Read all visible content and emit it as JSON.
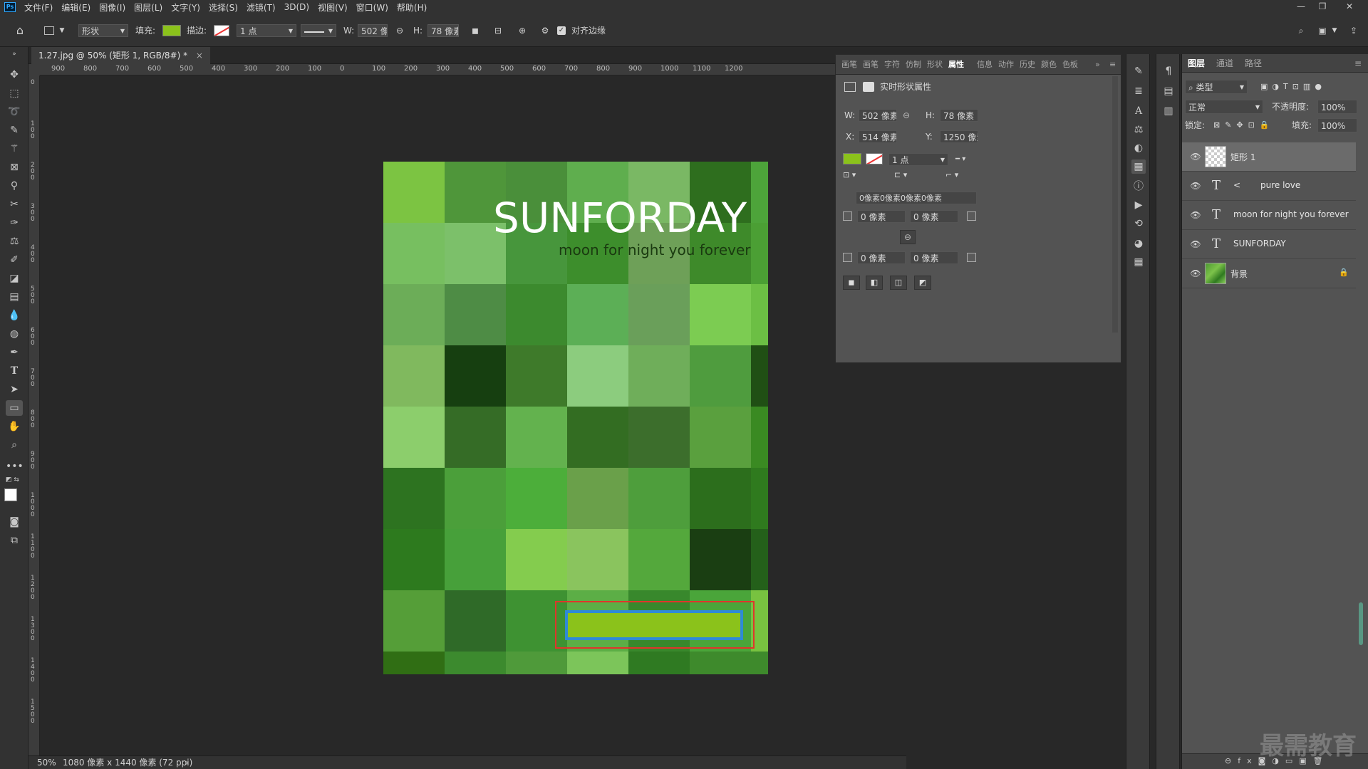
{
  "app": {
    "logo": "Ps"
  },
  "menu": [
    "文件(F)",
    "编辑(E)",
    "图像(I)",
    "图层(L)",
    "文字(Y)",
    "选择(S)",
    "滤镜(T)",
    "3D(D)",
    "视图(V)",
    "窗口(W)",
    "帮助(H)"
  ],
  "options": {
    "mode": "形状",
    "fill_label": "填充:",
    "stroke_label": "描边:",
    "stroke_width": "1 点",
    "w_label": "W:",
    "w_value": "502 像",
    "h_label": "H:",
    "h_value": "78 像素",
    "align_label": "对齐边缘",
    "fill_color": "#8bc21b"
  },
  "document": {
    "tab_title": "1.27.jpg @ 50% (矩形 1, RGB/8#) *",
    "close": "×"
  },
  "ruler": {
    "h_ticks": [
      "900",
      "800",
      "700",
      "600",
      "500",
      "400",
      "300",
      "200",
      "100",
      "0",
      "100",
      "200",
      "300",
      "400",
      "500",
      "600",
      "700",
      "800",
      "900",
      "1000",
      "1100",
      "1200"
    ],
    "v_ticks": [
      "0",
      "1 0 0",
      "2 0 0",
      "3 0 0",
      "4 0 0",
      "5 0 0",
      "6 0 0",
      "7 0 0",
      "8 0 0",
      "9 0 0",
      "1 0 0 0",
      "1 1 0 0",
      "1 2 0 0",
      "1 3 0 0",
      "1 4 0 0",
      "1 5 0 0"
    ]
  },
  "artwork": {
    "title": "SUNFORDAY",
    "subtitle": "moon for night you forever"
  },
  "status": {
    "zoom": "50%",
    "doc_info": "1080 像素 x 1440 像素 (72 ppi)"
  },
  "properties": {
    "tabs": [
      "画笔",
      "画笔",
      "字符",
      "仿制",
      "形状",
      "属性",
      "信息",
      "动作",
      "历史",
      "颜色",
      "色板"
    ],
    "header": "实时形状属性",
    "w_label": "W:",
    "w_value": "502 像素",
    "h_label": "H:",
    "h_value": "78 像素",
    "x_label": "X:",
    "x_value": "514 像素",
    "y_label": "Y:",
    "y_value": "1250 像素",
    "stroke_width": "1 点",
    "corner_all": "0像素0像素0像素0像素",
    "corner_tl": "0 像素",
    "corner_tr": "0 像素",
    "corner_bl": "0 像素",
    "corner_br": "0 像素"
  },
  "layers": {
    "tabs": [
      "图层",
      "通道",
      "路径"
    ],
    "filter": "类型",
    "blend_mode": "正常",
    "opacity_label": "不透明度:",
    "opacity_value": "100%",
    "lock_label": "锁定:",
    "fill_label": "填充:",
    "fill_value": "100%",
    "items": [
      {
        "name": "矩形 1",
        "kind": "shape"
      },
      {
        "name": "pure love",
        "kind": "text",
        "prefix": "<"
      },
      {
        "name": "moon for night you forever",
        "kind": "text"
      },
      {
        "name": "SUNFORDAY",
        "kind": "text"
      },
      {
        "name": "背景",
        "kind": "image"
      }
    ]
  },
  "watermark": "最需教育"
}
